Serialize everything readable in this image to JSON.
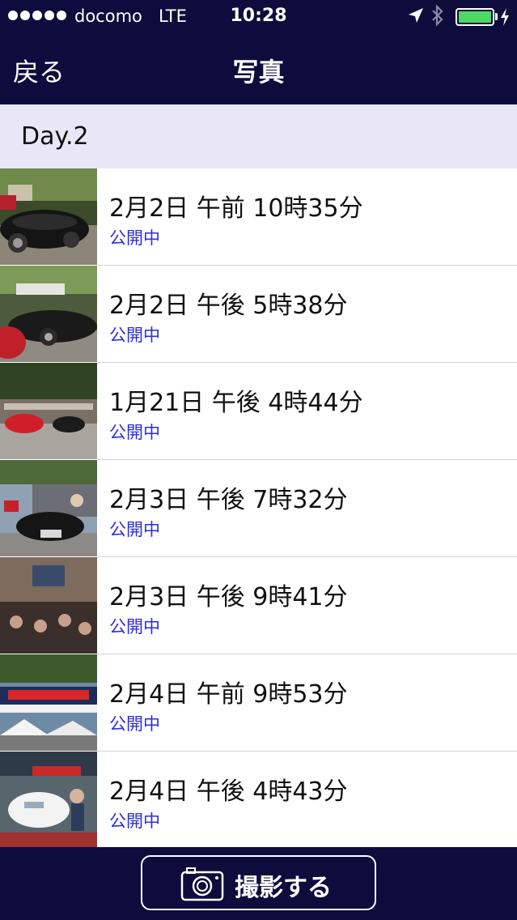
{
  "status_bar": {
    "carrier": "docomo",
    "network": "LTE",
    "time": "10:28",
    "icons": [
      "signal-dots-icon",
      "location-arrow-icon",
      "bluetooth-icon",
      "battery-icon",
      "charging-bolt-icon"
    ],
    "battery_color": "#4cd964",
    "signal_strength": 5
  },
  "nav": {
    "back_label": "戻る",
    "title": "写真"
  },
  "section": {
    "header": "Day.2"
  },
  "photos": [
    {
      "datetime": "2月2日 午前 10時35分",
      "status": "公開中",
      "thumb": "classic-car-photo"
    },
    {
      "datetime": "2月2日 午後 5時38分",
      "status": "公開中",
      "thumb": "classic-car-photo"
    },
    {
      "datetime": "1月21日 午後 4時44分",
      "status": "公開中",
      "thumb": "car-show-photo"
    },
    {
      "datetime": "2月3日 午後 7時32分",
      "status": "公開中",
      "thumb": "classic-car-crowd-photo"
    },
    {
      "datetime": "2月3日 午後 9時41分",
      "status": "公開中",
      "thumb": "crowd-event-photo"
    },
    {
      "datetime": "2月4日 午前 9時53分",
      "status": "公開中",
      "thumb": "event-banner-photo"
    },
    {
      "datetime": "2月4日 午後 4時43分",
      "status": "公開中",
      "thumb": "white-sports-car-photo"
    }
  ],
  "bottom": {
    "camera_label": "撮影する",
    "camera_icon": "camera-icon"
  },
  "colors": {
    "bar_background": "#0d0c3d",
    "section_background": "#e9e6f6",
    "status_text": "#2d2fd8"
  }
}
